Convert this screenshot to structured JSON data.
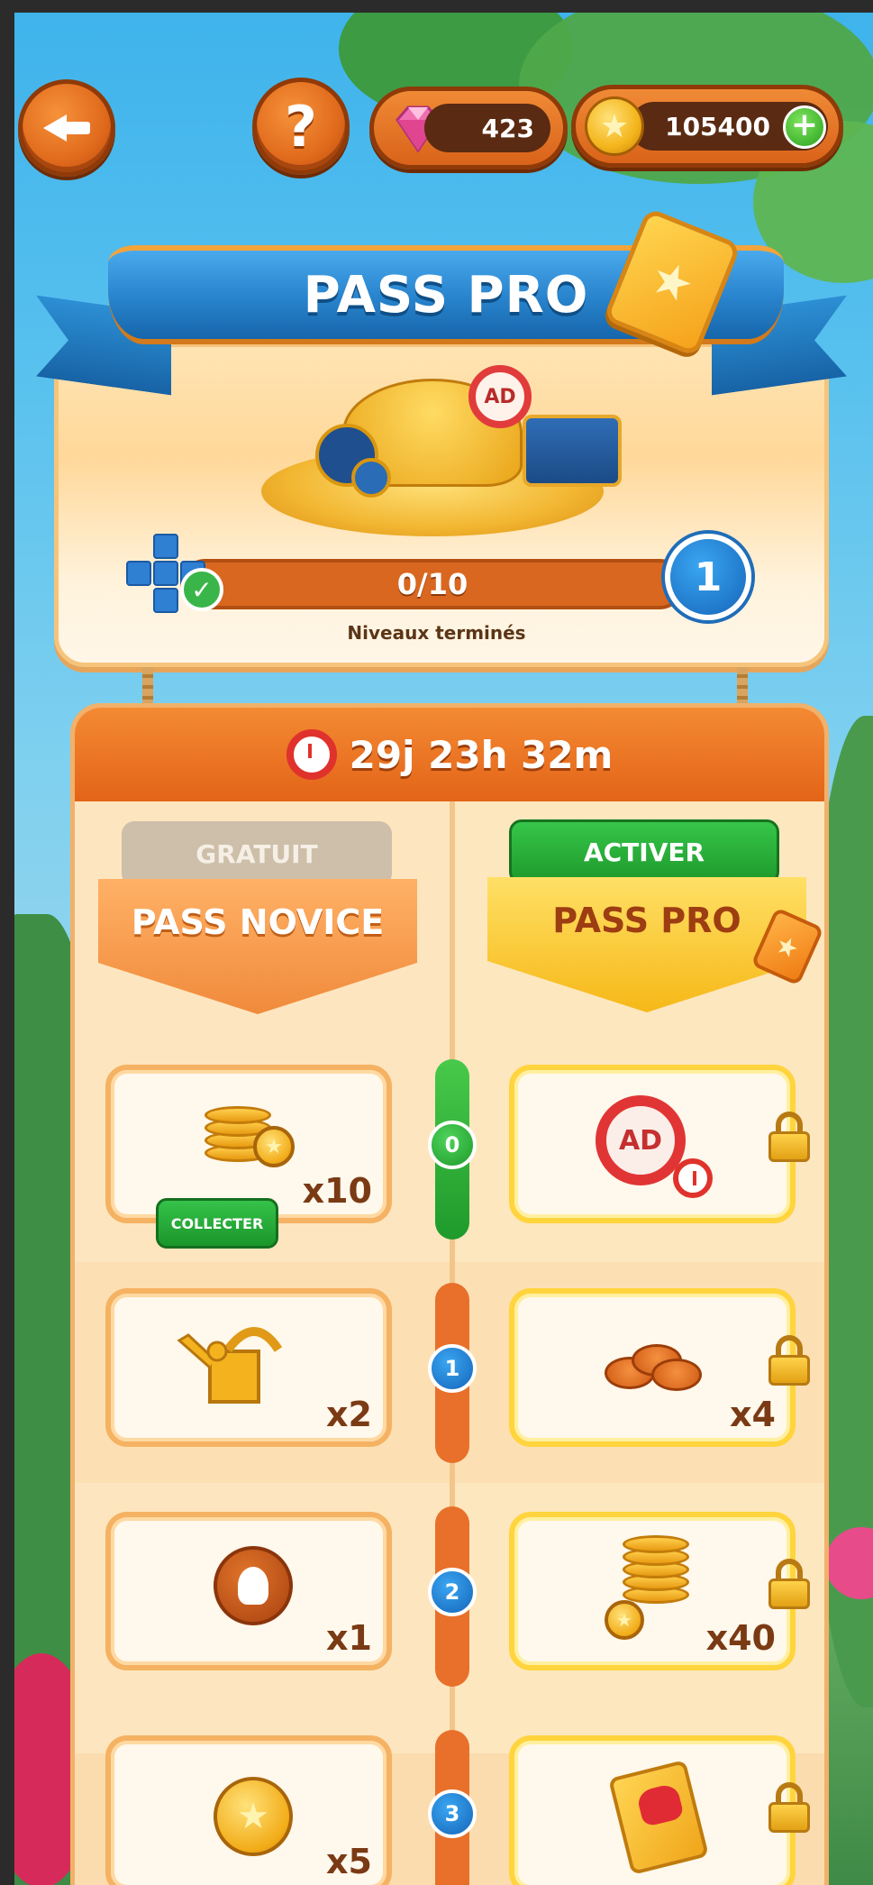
{
  "top_bar": {
    "back_label": "",
    "help_label": "?",
    "gems": "423",
    "coins": "105400",
    "plus_label": "+"
  },
  "banner": {
    "title": "PASS PRO",
    "progress_text": "0/10",
    "progress_fraction": 0,
    "levels_label": "Niveaux terminés",
    "current_level": "1",
    "no_ad_label": "AD"
  },
  "timer": {
    "text": "29j 23h 32m"
  },
  "tracks": {
    "free_tag": "GRATUIT",
    "free_title": "PASS NOVICE",
    "pro_tag": "ACTIVER",
    "pro_title": "PASS PRO"
  },
  "rows": [
    {
      "level": "0",
      "free_qty": "x10",
      "free_item": "coins",
      "collect_label": "COLLECTER",
      "pro_qty": "",
      "pro_item": "no-ads",
      "pro_icon_text": "AD"
    },
    {
      "level": "1",
      "free_qty": "x2",
      "free_item": "watering-can",
      "pro_qty": "x4",
      "pro_item": "chips"
    },
    {
      "level": "2",
      "free_qty": "x1",
      "free_item": "hint-bulb",
      "pro_qty": "x40",
      "pro_item": "coins"
    },
    {
      "level": "3",
      "free_qty": "x5",
      "free_item": "star-coin",
      "pro_qty": "",
      "pro_item": "gift-card"
    }
  ],
  "colors": {
    "accent_orange": "#e36418",
    "accent_blue": "#1565b9",
    "accent_green": "#1e9a2b",
    "panel_bg": "#fbe7c2"
  }
}
